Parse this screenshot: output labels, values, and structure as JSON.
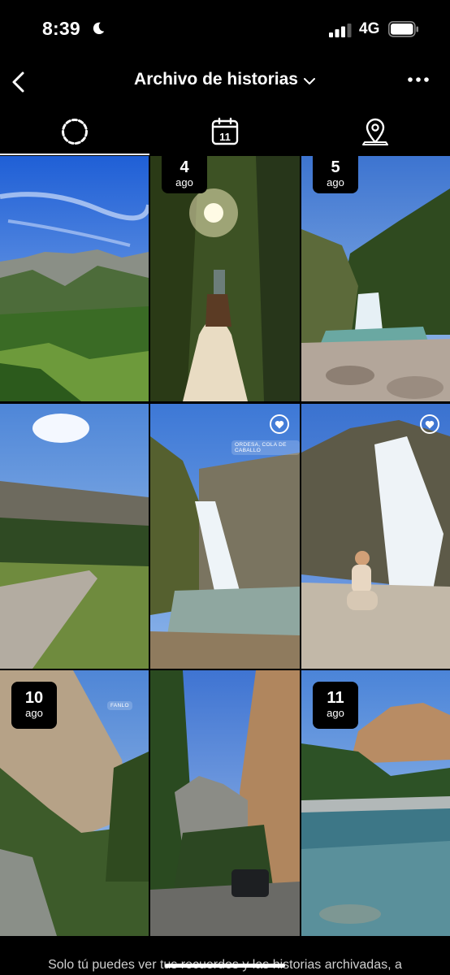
{
  "status_bar": {
    "time": "8:39",
    "network": "4G",
    "icons": [
      "moon-icon",
      "signal-icon",
      "battery-icon"
    ]
  },
  "header": {
    "title": "Archivo de historias",
    "icons": [
      "back-icon",
      "chevron-down-icon",
      "more-icon"
    ]
  },
  "tabs": [
    {
      "name": "stories",
      "icon": "stories-ring-icon",
      "active": true
    },
    {
      "name": "calendar",
      "icon": "calendar-icon",
      "label": "11"
    },
    {
      "name": "map",
      "icon": "location-pin-icon"
    }
  ],
  "stories": [
    {
      "id": 1,
      "badge": null,
      "heart": false
    },
    {
      "id": 2,
      "badge": {
        "day": "4",
        "month": "ago"
      },
      "heart": true
    },
    {
      "id": 3,
      "badge": {
        "day": "5",
        "month": "ago"
      },
      "heart": false
    },
    {
      "id": 4,
      "badge": null,
      "heart": false
    },
    {
      "id": 5,
      "badge": null,
      "heart": true,
      "location": "ORDESA, COLA DE CABALLO"
    },
    {
      "id": 6,
      "badge": null,
      "heart": true
    },
    {
      "id": 7,
      "badge": {
        "day": "10",
        "month": "ago"
      },
      "heart": false,
      "location": "FANLO"
    },
    {
      "id": 8,
      "badge": null,
      "heart": false
    },
    {
      "id": 9,
      "badge": {
        "day": "11",
        "month": "ago"
      },
      "heart": false
    }
  ],
  "footer": {
    "text": "Solo tú puedes ver tus recuerdos y las historias archivadas, a"
  },
  "colors": {
    "background": "#000000",
    "text": "#ffffff",
    "footer_text": "#cfcfcf"
  }
}
